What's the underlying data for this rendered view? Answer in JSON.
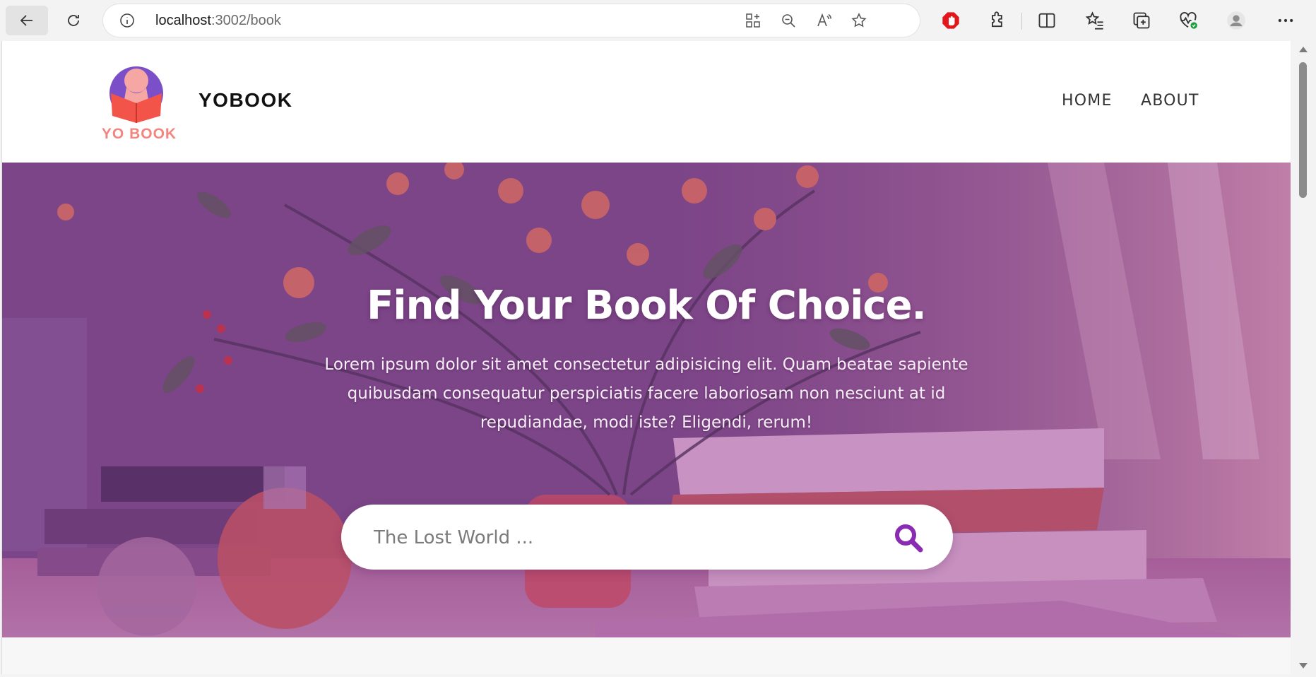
{
  "browser": {
    "url_host": "localhost",
    "url_path": ":3002/book",
    "icons": [
      "back-arrow-icon",
      "reload-icon",
      "info-icon",
      "app-grid-icon",
      "zoom-out-icon",
      "read-aloud-icon",
      "favorite-star-icon",
      "adblock-icon",
      "extensions-icon",
      "split-screen-icon",
      "favorites-list-icon",
      "collections-icon",
      "browser-health-icon",
      "profile-icon",
      "more-icon"
    ]
  },
  "header": {
    "logo_caption": "YO BOOK",
    "brand": "YOBOOK",
    "nav": [
      {
        "label": "HOME"
      },
      {
        "label": "ABOUT"
      }
    ]
  },
  "hero": {
    "title": "Find Your Book Of Choice.",
    "text": "Lorem ipsum dolor sit amet consectetur adipisicing elit. Quam beatae sapiente quibusdam consequatur perspiciatis facere laboriosam non nesciunt at id repudiandae, modi iste? Eligendi, rerum!",
    "search_placeholder": "The Lost World ...",
    "search_value": ""
  },
  "colors": {
    "accent_purple": "#8a2bb3",
    "logo_pink": "#f2867f",
    "logo_red": "#f25449",
    "logo_violet": "#7a4fc7"
  }
}
